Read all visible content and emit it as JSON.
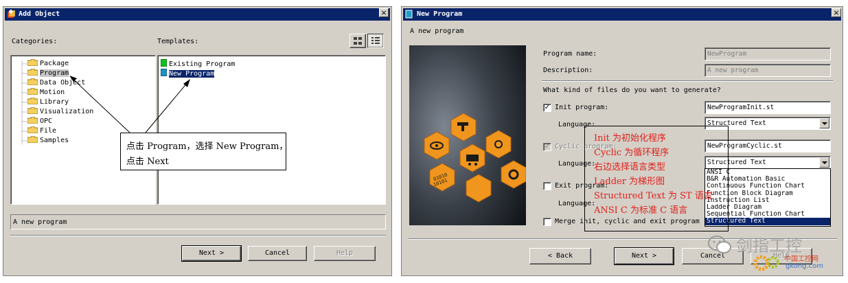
{
  "add_object": {
    "title": "Add Object",
    "close": "×",
    "categories_label": "Categories:",
    "templates_label": "Templates:",
    "view_large_icons": "large-icons-view-icon",
    "view_list": "list-view-icon",
    "categories": [
      "Package",
      "Program",
      "Data Object",
      "Motion",
      "Library",
      "Visualization",
      "OPC",
      "File",
      "Samples"
    ],
    "templates": [
      "Existing Program",
      "New Program"
    ],
    "description": "A new program",
    "buttons": {
      "next": "Next >",
      "cancel": "Cancel",
      "help": "Help"
    },
    "annotation_line1": "点击 Program，选择 New Program，",
    "annotation_line2": "点击 Next"
  },
  "new_program": {
    "title": "New Program",
    "close": "×",
    "subtitle": "A new program",
    "program_name_label": "Program name:",
    "program_name_value": "NewProgram",
    "description_label": "Description:",
    "description_value": "A new program",
    "question": "What kind of files do you want to generate?",
    "init_label": "Init program:",
    "init_checked": true,
    "init_value": "NewProgramInit.st",
    "language_label": "Language:",
    "init_language": "Structured Text",
    "cyclic_label": "Cyclic program:",
    "cyclic_checked": true,
    "cyclic_value": "NewProgramCyclic.st",
    "cyclic_language": "Structured Text",
    "exit_label": "Exit program:",
    "exit_checked": false,
    "merge_label": "Merge init, cyclic and exit program",
    "merge_checked": false,
    "language_options": [
      "ANSI C",
      "B&R Automation Basic",
      "Continuous Function Chart",
      "Function Block Diagram",
      "Instruction List",
      "Ladder Diagram",
      "Sequential Function Chart",
      "Structured Text"
    ],
    "selected_option": "Structured Text",
    "buttons": {
      "back": "< Back",
      "next": "Next >",
      "cancel": "Cancel",
      "help": "Help"
    },
    "annotations": [
      "Init 为初始化程序",
      "Cyclic 为循环程序",
      "右边选择语言类型",
      "Ladder 为梯形图",
      "Structured Text 为 ST 语言",
      "ANSI C  为标准 C 语言"
    ]
  },
  "watermark": {
    "text": "剑指工控",
    "site_cn": "中国工控网",
    "site": "gkong.com"
  },
  "colors": {
    "title_bg": "#0a246a",
    "face": "#d4d0c8",
    "annotation_red": "#e0201a",
    "hex_orange": "#f0961e"
  }
}
